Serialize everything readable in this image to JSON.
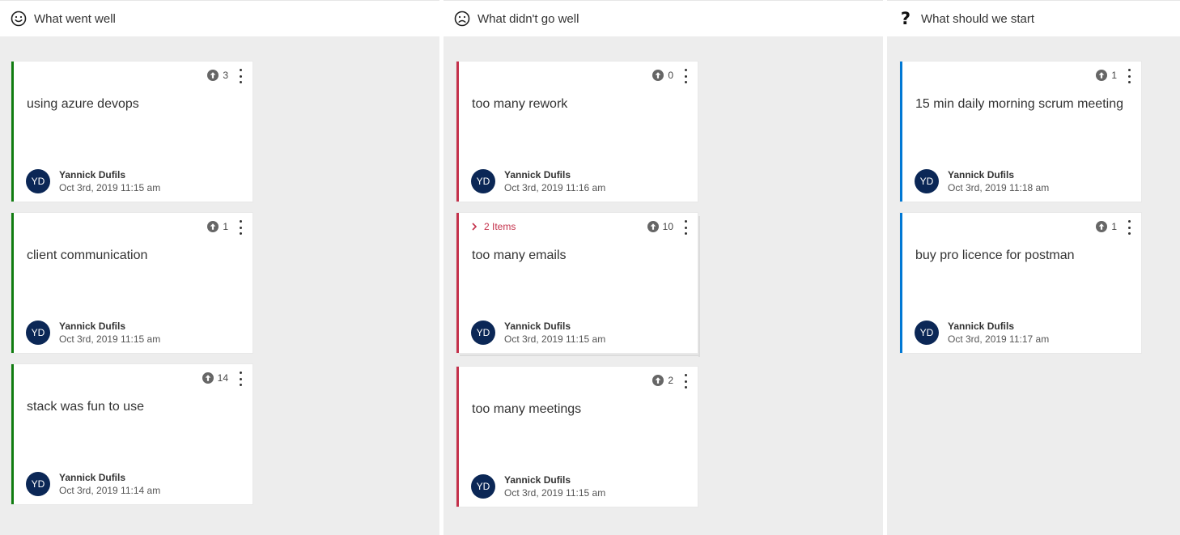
{
  "columns": [
    {
      "title": "What went well",
      "icon": "smile-icon",
      "accent": "#107c10",
      "cards": [
        {
          "text": "using azure devops",
          "votes": "3",
          "author": "Yannick Dufils",
          "initials": "YD",
          "date": "Oct 3rd, 2019 11:15 am"
        },
        {
          "text": "client communication",
          "votes": "1",
          "author": "Yannick Dufils",
          "initials": "YD",
          "date": "Oct 3rd, 2019 11:15 am"
        },
        {
          "text": "stack was fun to use",
          "votes": "14",
          "author": "Yannick Dufils",
          "initials": "YD",
          "date": "Oct 3rd, 2019 11:14 am"
        }
      ]
    },
    {
      "title": "What didn't go well",
      "icon": "frown-icon",
      "accent": "#c4314b",
      "cards": [
        {
          "text": "too many rework",
          "votes": "0",
          "author": "Yannick Dufils",
          "initials": "YD",
          "date": "Oct 3rd, 2019 11:16 am"
        },
        {
          "text": "too many emails",
          "votes": "10",
          "group_label": "2 Items",
          "author": "Yannick Dufils",
          "initials": "YD",
          "date": "Oct 3rd, 2019 11:15 am"
        },
        {
          "text": "too many meetings",
          "votes": "2",
          "author": "Yannick Dufils",
          "initials": "YD",
          "date": "Oct 3rd, 2019 11:15 am"
        }
      ]
    },
    {
      "title": "What should we start",
      "icon": "question-mark-icon",
      "icon_glyph": "?",
      "accent": "#0078d4",
      "cards": [
        {
          "text": "15 min daily morning scrum meeting",
          "votes": "1",
          "author": "Yannick Dufils",
          "initials": "YD",
          "date": "Oct 3rd, 2019 11:18 am"
        },
        {
          "text": "buy pro licence for postman",
          "votes": "1",
          "author": "Yannick Dufils",
          "initials": "YD",
          "date": "Oct 3rd, 2019 11:17 am"
        }
      ]
    }
  ]
}
